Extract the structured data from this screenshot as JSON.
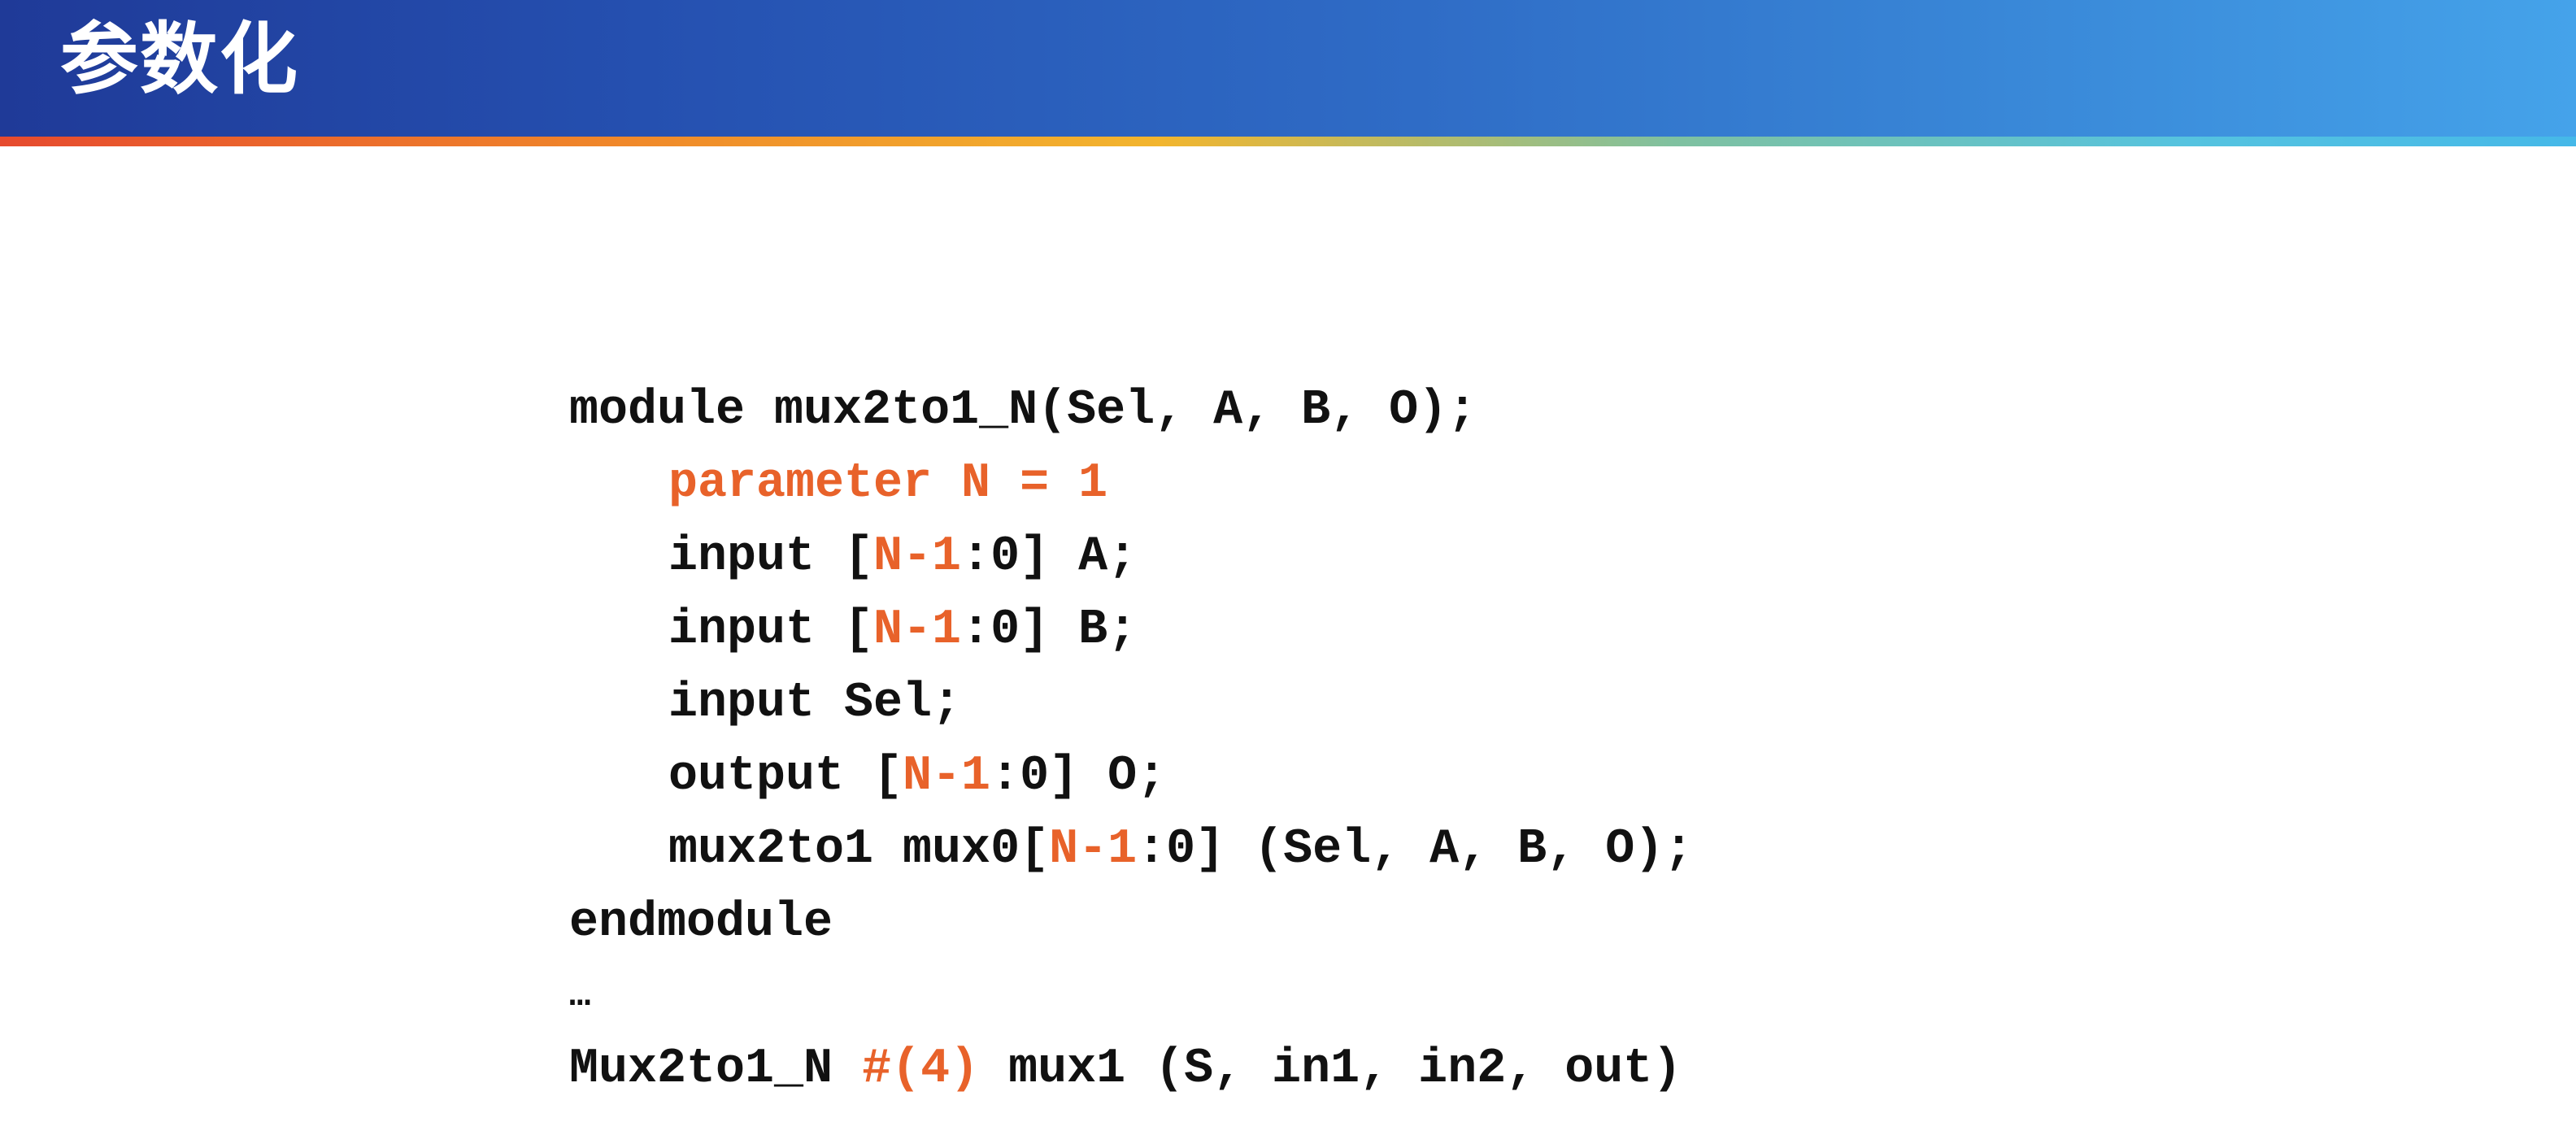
{
  "title": "参数化",
  "colors": {
    "code_text": "#111111",
    "highlight": "#e8622a",
    "title_text": "#ffffff",
    "header_gradient_start": "#1f3a98",
    "header_gradient_end": "#45a3ea"
  },
  "code": {
    "line1": "module mux2to1_N(Sel, A, B, O);",
    "line2": "parameter N = 1",
    "line3": {
      "a": "input [",
      "b": "N-1",
      "c": ":0] A;"
    },
    "line4": {
      "a": "input [",
      "b": "N-1",
      "c": ":0] B;"
    },
    "line5": "input Sel;",
    "line6": {
      "a": "output [",
      "b": "N-1",
      "c": ":0] O;"
    },
    "line7": {
      "a": "mux2to1 mux0[",
      "b": "N-1",
      "c": ":0] (Sel, A, B, O);"
    },
    "line8": "endmodule",
    "line9": "…",
    "line10": {
      "a": "Mux2to1_N ",
      "b": "#(4)",
      "c": " mux1 (S, in1, in2, out)"
    }
  }
}
